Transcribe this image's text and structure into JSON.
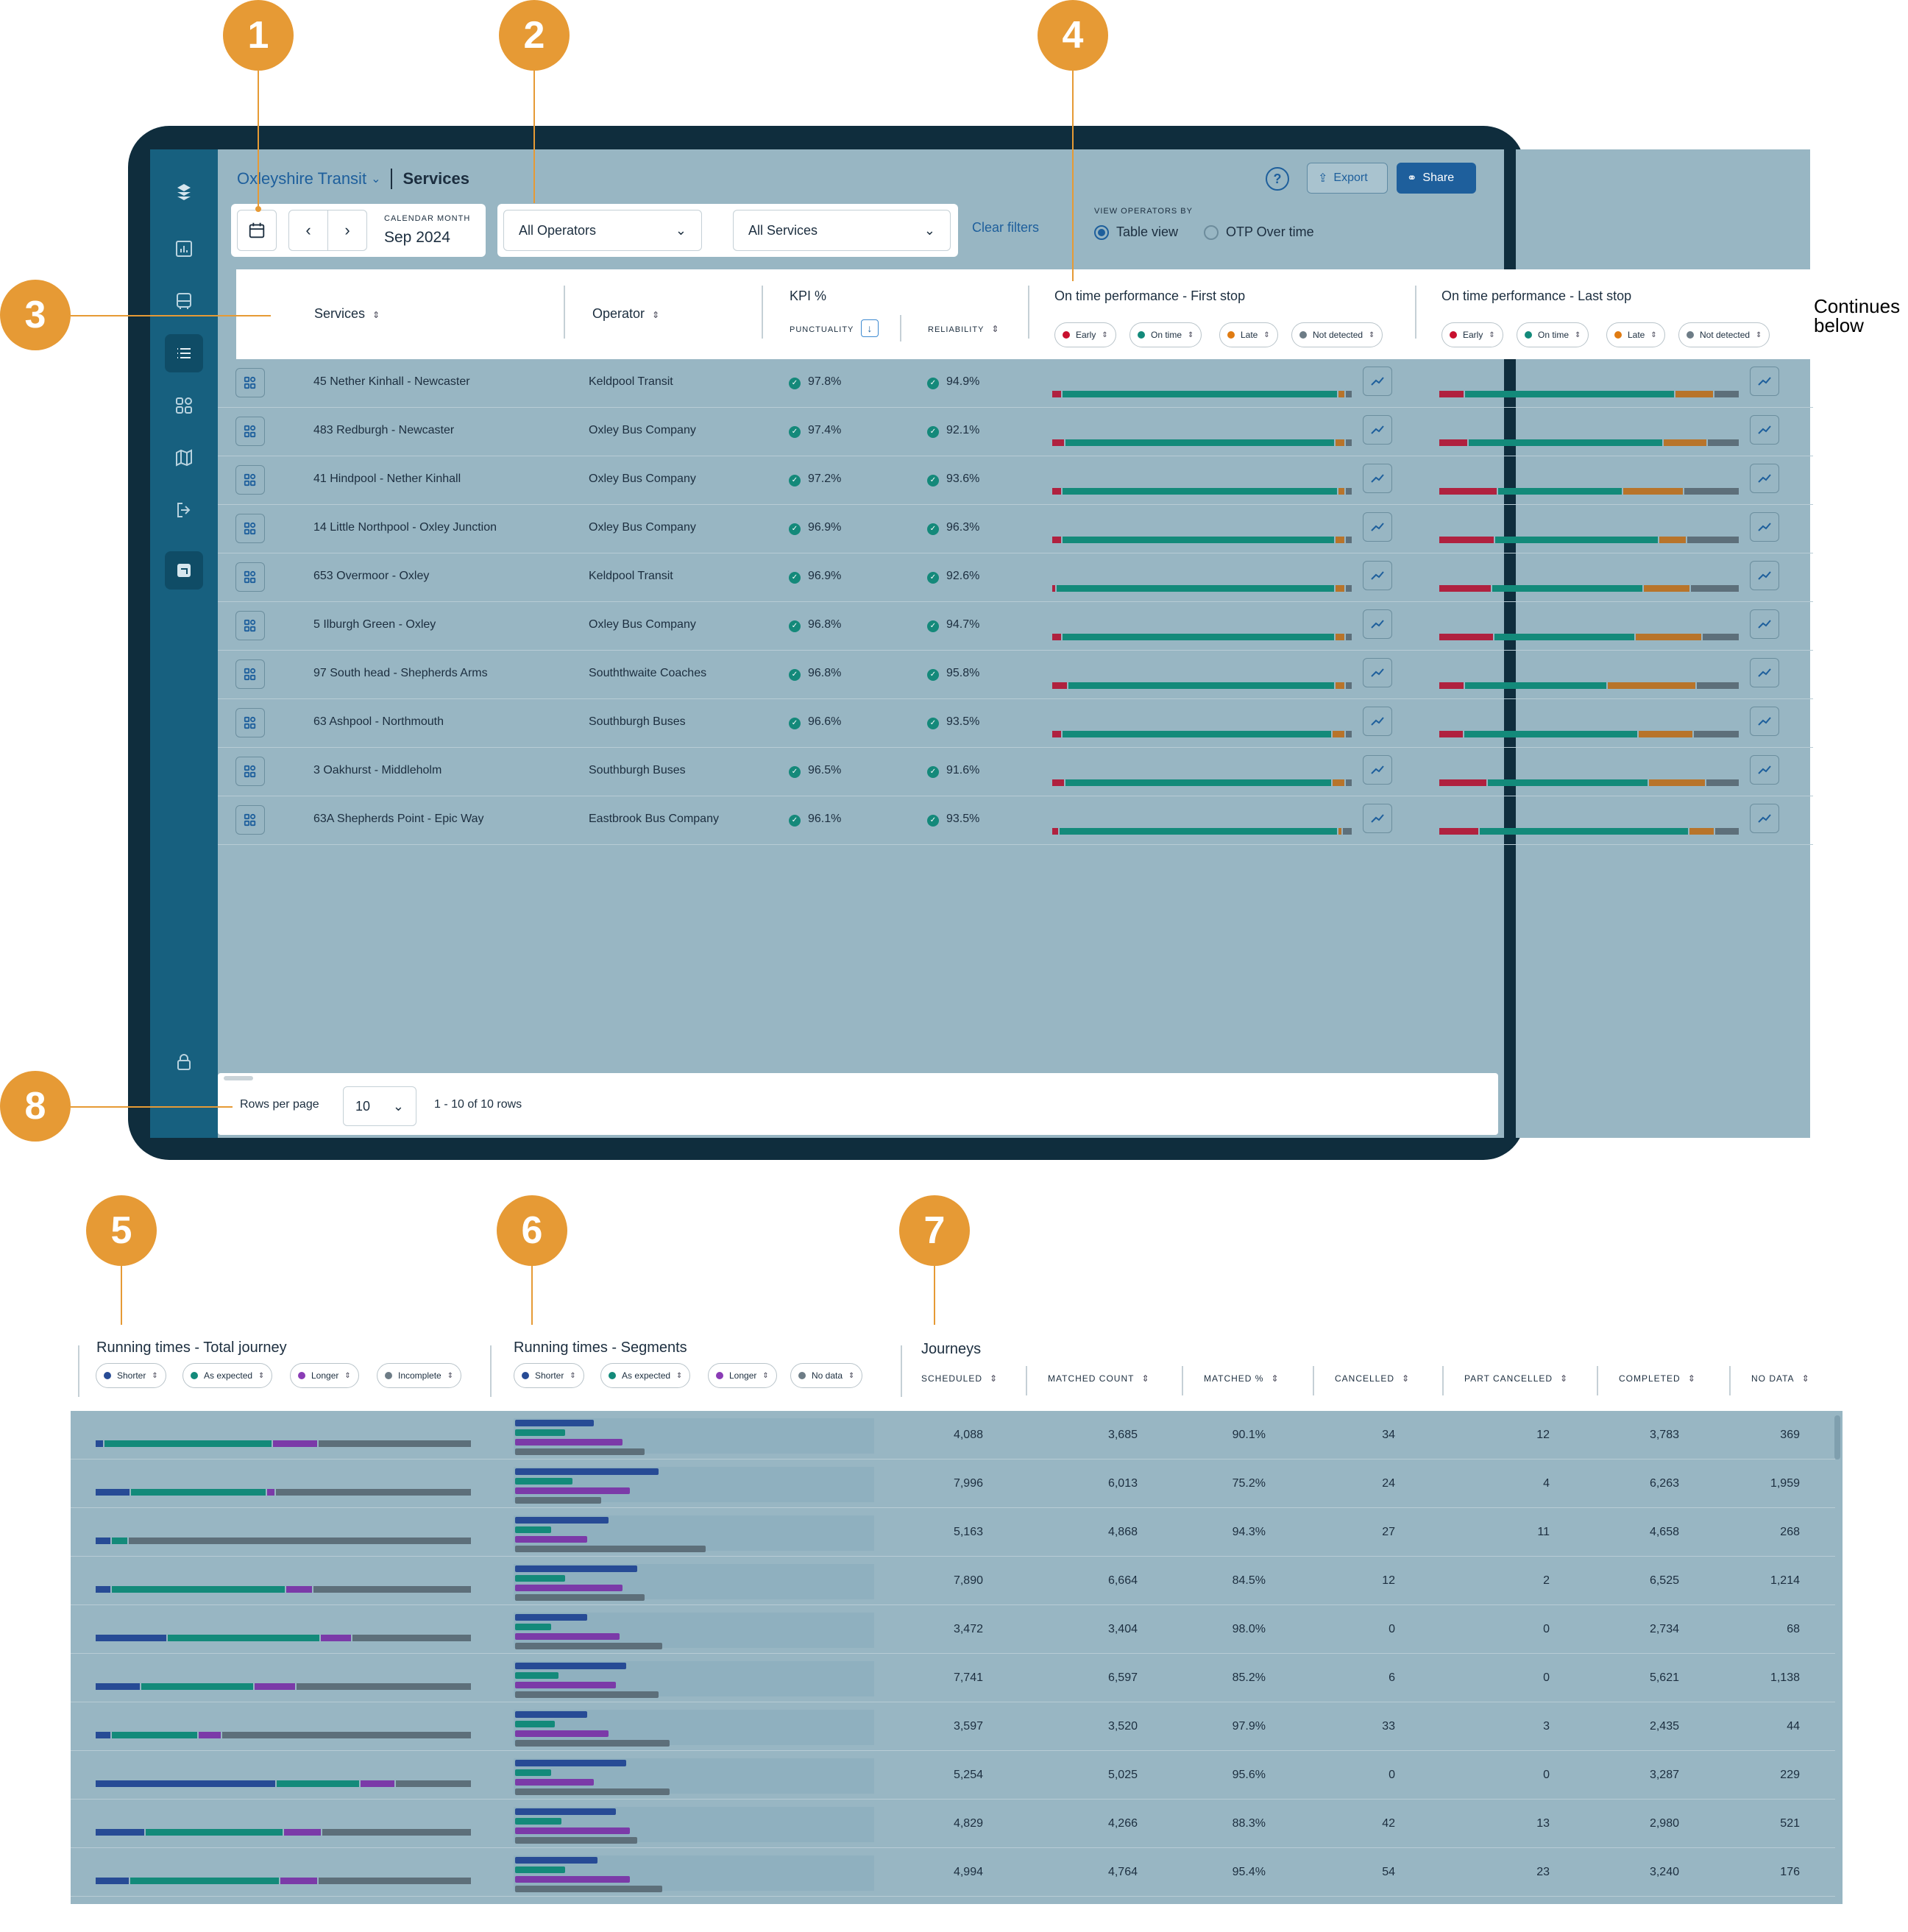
{
  "callouts": [
    "1",
    "2",
    "3",
    "4",
    "5",
    "6",
    "7",
    "8"
  ],
  "continues_note": [
    "Continues",
    "below"
  ],
  "header": {
    "org": "Oxleyshire Transit",
    "page_title": "Services",
    "export_label": "Export",
    "share_label": "Share",
    "help": "?"
  },
  "filters": {
    "month_label": "CALENDAR MONTH",
    "month_value": "Sep 2024",
    "operators": "All Operators",
    "services": "All Services",
    "clear": "Clear filters",
    "view_by_label": "VIEW OPERATORS BY",
    "view_options": [
      "Table view",
      "OTP Over time"
    ],
    "view_selected": "Table view"
  },
  "table": {
    "headers": {
      "services": "Services",
      "operator": "Operator",
      "kpi": "KPI %",
      "punctuality": "PUNCTUALITY",
      "reliability": "RELIABILITY",
      "otp_first": "On time performance - First stop",
      "otp_last": "On time performance - Last stop"
    },
    "otp_chips": [
      "Early",
      "On time",
      "Late",
      "Not detected"
    ],
    "colors": {
      "early": "#b0213f",
      "on_time": "#138a7a",
      "late": "#b8742a",
      "not_detected": "#5d6f7a",
      "shorter": "#274b95",
      "as_expected": "#138a7a",
      "longer": "#7b3aa8",
      "incomplete": "#5d6f7a"
    },
    "rows": [
      {
        "service": "45 Nether Kinhall - Newcaster",
        "operator": "Keldpool Transit",
        "punctuality": "97.8%",
        "reliability": "94.9%",
        "first": [
          0.03,
          0.92,
          0.02,
          0.02
        ],
        "last": [
          0.08,
          0.68,
          0.12,
          0.08
        ]
      },
      {
        "service": "483 Redburgh - Newcaster",
        "operator": "Oxley Bus Company",
        "punctuality": "97.4%",
        "reliability": "92.1%",
        "first": [
          0.04,
          0.9,
          0.03,
          0.02
        ],
        "last": [
          0.09,
          0.63,
          0.14,
          0.1
        ]
      },
      {
        "service": "41 Hindpool - Nether Kinhall",
        "operator": "Oxley Bus Company",
        "punctuality": "97.2%",
        "reliability": "93.6%",
        "first": [
          0.03,
          0.91,
          0.02,
          0.02
        ],
        "last": [
          0.19,
          0.41,
          0.2,
          0.18
        ]
      },
      {
        "service": "14 Little Northpool - Oxley Junction",
        "operator": "Oxley Bus Company",
        "punctuality": "96.9%",
        "reliability": "96.3%",
        "first": [
          0.03,
          0.91,
          0.03,
          0.02
        ],
        "last": [
          0.18,
          0.54,
          0.09,
          0.17
        ]
      },
      {
        "service": "653 Overmoor - Oxley",
        "operator": "Keldpool Transit",
        "punctuality": "96.9%",
        "reliability": "92.6%",
        "first": [
          0.01,
          0.93,
          0.03,
          0.02
        ],
        "last": [
          0.17,
          0.5,
          0.15,
          0.16
        ]
      },
      {
        "service": "5 Ilburgh Green - Oxley",
        "operator": "Oxley Bus Company",
        "punctuality": "96.8%",
        "reliability": "94.7%",
        "first": [
          0.03,
          0.91,
          0.03,
          0.02
        ],
        "last": [
          0.18,
          0.47,
          0.22,
          0.12
        ]
      },
      {
        "service": "97 South head - Shepherds Arms",
        "operator": "Souththwaite Coaches",
        "punctuality": "96.8%",
        "reliability": "95.8%",
        "first": [
          0.05,
          0.89,
          0.03,
          0.02
        ],
        "last": [
          0.08,
          0.47,
          0.29,
          0.14
        ]
      },
      {
        "service": "63 Ashpool - Northmouth",
        "operator": "Southburgh Buses",
        "punctuality": "96.6%",
        "reliability": "93.5%",
        "first": [
          0.03,
          0.9,
          0.04,
          0.02
        ],
        "last": [
          0.08,
          0.58,
          0.18,
          0.15
        ]
      },
      {
        "service": "3 Oakhurst - Middleholm",
        "operator": "Southburgh Buses",
        "punctuality": "96.5%",
        "reliability": "91.6%",
        "first": [
          0.04,
          0.89,
          0.04,
          0.02
        ],
        "last": [
          0.16,
          0.54,
          0.19,
          0.11
        ]
      },
      {
        "service": "63A Shepherds Point - Epic Way",
        "operator": "Eastbrook Bus Company",
        "punctuality": "96.1%",
        "reliability": "93.5%",
        "first": [
          0.02,
          0.93,
          0.01,
          0.03
        ],
        "last": [
          0.13,
          0.7,
          0.08,
          0.08
        ]
      }
    ]
  },
  "footer": {
    "rows_per_page_label": "Rows per page",
    "rows_per_page": "10",
    "count": "1 - 10 of 10 rows"
  },
  "lower": {
    "running_total_title": "Running times - Total journey",
    "running_total_chips": [
      "Shorter",
      "As expected",
      "Longer",
      "Incomplete"
    ],
    "segments_title": "Running times - Segments",
    "segments_chips": [
      "Shorter",
      "As expected",
      "Longer",
      "No data"
    ],
    "journeys_title": "Journeys",
    "journey_columns": [
      "SCHEDULED",
      "MATCHED COUNT",
      "MATCHED %",
      "CANCELLED",
      "PART CANCELLED",
      "COMPLETED",
      "NO DATA"
    ],
    "rows": [
      {
        "total": [
          0.02,
          0.45,
          0.12,
          0.41
        ],
        "segments": [
          0.22,
          0.14,
          0.3,
          0.36
        ],
        "journeys": [
          "4,088",
          "3,685",
          "90.1%",
          "34",
          "12",
          "3,783",
          "369"
        ]
      },
      {
        "total": [
          0.09,
          0.36,
          0.02,
          0.52
        ],
        "segments": [
          0.4,
          0.16,
          0.32,
          0.24
        ],
        "journeys": [
          "7,996",
          "6,013",
          "75.2%",
          "24",
          "4",
          "6,263",
          "1,959"
        ]
      },
      {
        "total": [
          0.04,
          0.04,
          0,
          0.91
        ],
        "segments": [
          0.26,
          0.1,
          0.2,
          0.53
        ],
        "journeys": [
          "5,163",
          "4,868",
          "94.3%",
          "27",
          "11",
          "4,658",
          "268"
        ]
      },
      {
        "total": [
          0.04,
          0.46,
          0.07,
          0.42
        ],
        "segments": [
          0.34,
          0.14,
          0.3,
          0.36
        ],
        "journeys": [
          "7,890",
          "6,664",
          "84.5%",
          "12",
          "2",
          "6,525",
          "1,214"
        ]
      },
      {
        "total": [
          0.19,
          0.41,
          0.08,
          0.32
        ],
        "segments": [
          0.2,
          0.1,
          0.29,
          0.41
        ],
        "journeys": [
          "3,472",
          "3,404",
          "98.0%",
          "0",
          "0",
          "2,734",
          "68"
        ]
      },
      {
        "total": [
          0.12,
          0.3,
          0.11,
          0.47
        ],
        "segments": [
          0.31,
          0.12,
          0.28,
          0.4
        ],
        "journeys": [
          "7,741",
          "6,597",
          "85.2%",
          "6",
          "0",
          "5,621",
          "1,138"
        ]
      },
      {
        "total": [
          0.04,
          0.23,
          0.06,
          0.67
        ],
        "segments": [
          0.2,
          0.11,
          0.26,
          0.43
        ],
        "journeys": [
          "3,597",
          "3,520",
          "97.9%",
          "33",
          "3",
          "2,435",
          "44"
        ]
      },
      {
        "total": [
          0.48,
          0.22,
          0.09,
          0.2
        ],
        "segments": [
          0.31,
          0.1,
          0.22,
          0.43
        ],
        "journeys": [
          "5,254",
          "5,025",
          "95.6%",
          "0",
          "0",
          "3,287",
          "229"
        ]
      },
      {
        "total": [
          0.13,
          0.37,
          0.1,
          0.4
        ],
        "segments": [
          0.28,
          0.13,
          0.32,
          0.34
        ],
        "journeys": [
          "4,829",
          "4,266",
          "88.3%",
          "42",
          "13",
          "2,980",
          "521"
        ]
      },
      {
        "total": [
          0.09,
          0.4,
          0.1,
          0.41
        ],
        "segments": [
          0.23,
          0.14,
          0.32,
          0.41
        ],
        "journeys": [
          "4,994",
          "4,764",
          "95.4%",
          "54",
          "23",
          "3,240",
          "176"
        ]
      }
    ]
  }
}
